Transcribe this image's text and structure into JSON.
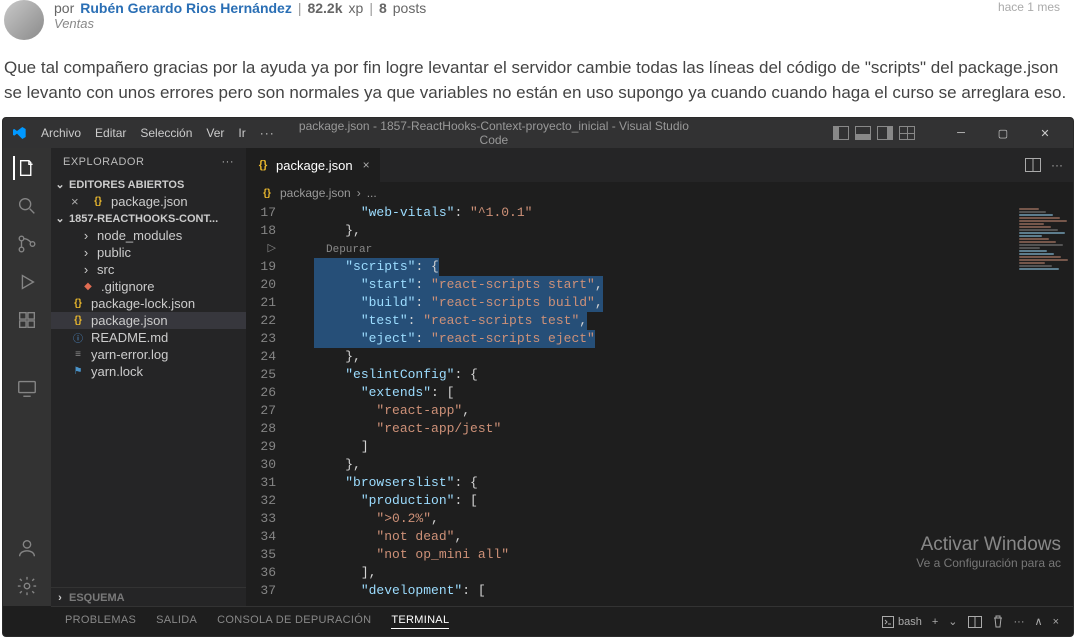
{
  "forum": {
    "byLabel": "por",
    "author": "Rubén Gerardo Rios Hernández",
    "xp": "82.2k",
    "xpLabel": "xp",
    "postsCount": "8",
    "postsLabel": "posts",
    "role": "Ventas",
    "timeAgo": "hace 1 mes",
    "body": "Que tal compañero gracias por la ayuda ya por fin logre levantar el servidor cambie todas las líneas del código de \"scripts\" del package.json se levanto con unos errores pero son normales ya que variables no están en uso supongo ya cuando cuando haga el curso se arreglara eso."
  },
  "vscode": {
    "menu": [
      "Archivo",
      "Editar",
      "Selección",
      "Ver",
      "Ir",
      "···"
    ],
    "title": "package.json - 1857-ReactHooks-Context-proyecto_inicial - Visual Studio Code",
    "explorer": {
      "title": "EXPLORADOR",
      "more": "···",
      "openEditorsTitle": "EDITORES ABIERTOS",
      "openEditors": [
        {
          "icon": "braces",
          "name": "package.json",
          "close": "×"
        }
      ],
      "projectTitle": "1857-REACTHOOKS-CONT...",
      "tree": [
        {
          "icon": "chev",
          "name": "node_modules",
          "nested": true
        },
        {
          "icon": "chev",
          "name": "public",
          "nested": true
        },
        {
          "icon": "chev",
          "name": "src",
          "nested": true
        },
        {
          "icon": "git",
          "name": ".gitignore",
          "nested": true
        },
        {
          "icon": "braces",
          "name": "package-lock.json",
          "nested": false
        },
        {
          "icon": "braces",
          "name": "package.json",
          "nested": false,
          "selected": true
        },
        {
          "icon": "info",
          "name": "README.md",
          "nested": false
        },
        {
          "icon": "file",
          "name": "yarn-error.log",
          "nested": false
        },
        {
          "icon": "yarn",
          "name": "yarn.lock",
          "nested": false
        }
      ],
      "outlineTitle": "ESQUEMA"
    },
    "tab": {
      "name": "package.json"
    },
    "breadcrumb": {
      "file": "package.json",
      "sep": "›",
      "rest": "..."
    },
    "debugHint": "Depurar",
    "code": {
      "startLine": 17,
      "lines": [
        {
          "n": 17,
          "indent": 3,
          "parts": [
            [
              "key",
              "\"web-vitals\""
            ],
            [
              "punc",
              ": "
            ],
            [
              "str",
              "\"^1.0.1\""
            ]
          ]
        },
        {
          "n": 18,
          "indent": 2,
          "parts": [
            [
              "punc",
              "},"
            ]
          ]
        },
        {
          "n": "debug"
        },
        {
          "n": 19,
          "indent": 2,
          "hl": true,
          "parts": [
            [
              "key",
              "\"scripts\""
            ],
            [
              "punc",
              ": "
            ],
            [
              "brace",
              "{"
            ]
          ]
        },
        {
          "n": 20,
          "indent": 3,
          "hl": true,
          "parts": [
            [
              "key",
              "\"start\""
            ],
            [
              "punc",
              ": "
            ],
            [
              "str",
              "\"react-scripts start\""
            ],
            [
              "punc",
              ","
            ]
          ]
        },
        {
          "n": 21,
          "indent": 3,
          "hl": true,
          "parts": [
            [
              "key",
              "\"build\""
            ],
            [
              "punc",
              ": "
            ],
            [
              "str",
              "\"react-scripts build\""
            ],
            [
              "punc",
              ","
            ]
          ]
        },
        {
          "n": 22,
          "indent": 3,
          "hl": true,
          "parts": [
            [
              "key",
              "\"test\""
            ],
            [
              "punc",
              ": "
            ],
            [
              "str",
              "\"react-scripts test\""
            ],
            [
              "punc",
              ","
            ]
          ]
        },
        {
          "n": 23,
          "indent": 3,
          "hl": true,
          "parts": [
            [
              "key",
              "\"eject\""
            ],
            [
              "punc",
              ": "
            ],
            [
              "str",
              "\"react-scripts eject\""
            ]
          ]
        },
        {
          "n": 24,
          "indent": 2,
          "parts": [
            [
              "punc",
              "},"
            ]
          ]
        },
        {
          "n": 25,
          "indent": 2,
          "parts": [
            [
              "key",
              "\"eslintConfig\""
            ],
            [
              "punc",
              ": "
            ],
            [
              "brace",
              "{"
            ]
          ]
        },
        {
          "n": 26,
          "indent": 3,
          "parts": [
            [
              "key",
              "\"extends\""
            ],
            [
              "punc",
              ": "
            ],
            [
              "brace",
              "["
            ]
          ]
        },
        {
          "n": 27,
          "indent": 4,
          "parts": [
            [
              "str",
              "\"react-app\""
            ],
            [
              "punc",
              ","
            ]
          ]
        },
        {
          "n": 28,
          "indent": 4,
          "parts": [
            [
              "str",
              "\"react-app/jest\""
            ]
          ]
        },
        {
          "n": 29,
          "indent": 3,
          "parts": [
            [
              "brace",
              "]"
            ]
          ]
        },
        {
          "n": 30,
          "indent": 2,
          "parts": [
            [
              "punc",
              "},"
            ]
          ]
        },
        {
          "n": 31,
          "indent": 2,
          "parts": [
            [
              "key",
              "\"browserslist\""
            ],
            [
              "punc",
              ": "
            ],
            [
              "brace",
              "{"
            ]
          ]
        },
        {
          "n": 32,
          "indent": 3,
          "parts": [
            [
              "key",
              "\"production\""
            ],
            [
              "punc",
              ": "
            ],
            [
              "brace",
              "["
            ]
          ]
        },
        {
          "n": 33,
          "indent": 4,
          "parts": [
            [
              "str",
              "\">0.2%\""
            ],
            [
              "punc",
              ","
            ]
          ]
        },
        {
          "n": 34,
          "indent": 4,
          "parts": [
            [
              "str",
              "\"not dead\""
            ],
            [
              "punc",
              ","
            ]
          ]
        },
        {
          "n": 35,
          "indent": 4,
          "parts": [
            [
              "str",
              "\"not op_mini all\""
            ]
          ]
        },
        {
          "n": 36,
          "indent": 3,
          "parts": [
            [
              "brace",
              "]"
            ],
            [
              "punc",
              ","
            ]
          ]
        },
        {
          "n": 37,
          "indent": 3,
          "parts": [
            [
              "key",
              "\"development\""
            ],
            [
              "punc",
              ": "
            ],
            [
              "brace",
              "["
            ]
          ]
        }
      ]
    },
    "panels": {
      "tabs": [
        "PROBLEMAS",
        "SALIDA",
        "CONSOLA DE DEPURACIÓN",
        "TERMINAL"
      ],
      "activeIndex": 3,
      "right": {
        "shell": "bash",
        "plus": "+",
        "chev": "⌄",
        "split": "▯",
        "trash": "🗑",
        "more": "···",
        "up": "∧",
        "close": "×"
      }
    },
    "activate": {
      "t1": "Activar Windows",
      "t2": "Ve a Configuración para ac"
    }
  }
}
